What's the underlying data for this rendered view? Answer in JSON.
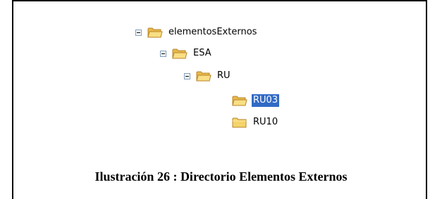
{
  "tree": {
    "nodes": [
      {
        "label": "elementosExternos",
        "expanded": true,
        "selected": false,
        "icon": "folder-open-icon"
      },
      {
        "label": "ESA",
        "expanded": true,
        "selected": false,
        "icon": "folder-open-icon"
      },
      {
        "label": "RU",
        "expanded": true,
        "selected": false,
        "icon": "folder-open-icon"
      },
      {
        "label": "RU03",
        "expanded": false,
        "selected": true,
        "icon": "folder-open-icon"
      },
      {
        "label": "RU10",
        "expanded": false,
        "selected": false,
        "icon": "folder-icon"
      }
    ]
  },
  "caption": "Ilustración 26 : Directorio Elementos Externos",
  "colors": {
    "selection": "#316ac5",
    "folder": "#f5d469"
  }
}
